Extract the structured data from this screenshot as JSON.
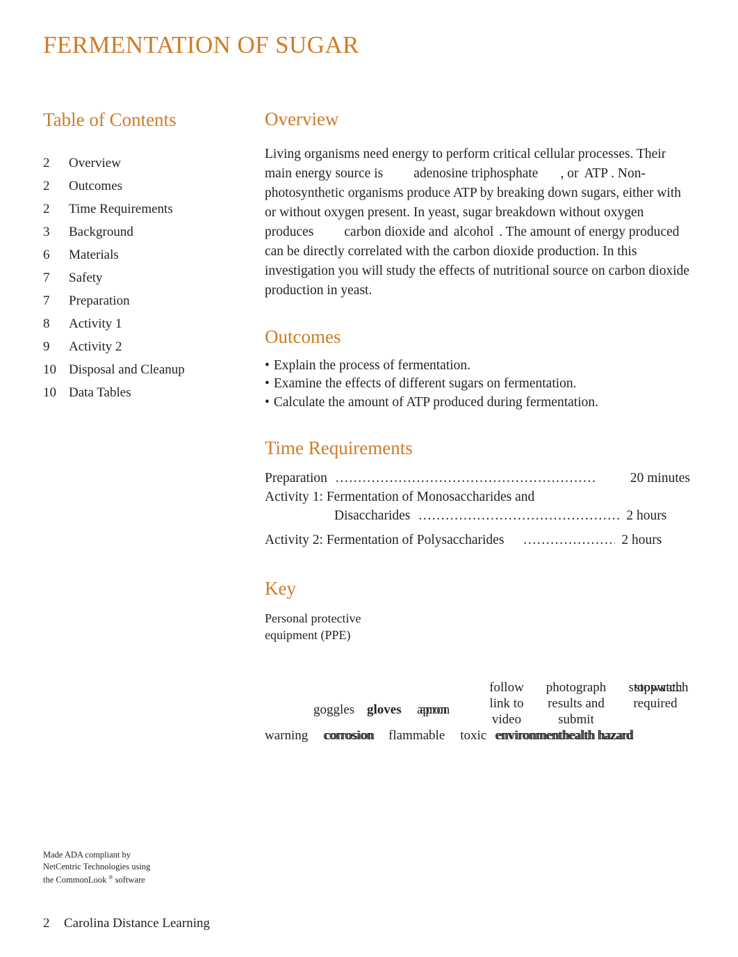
{
  "document": {
    "title": "FERMENTATION OF SUGAR",
    "accent_color": "#cf7b27",
    "text_color": "#231f20",
    "background_color": "#ffffff"
  },
  "toc": {
    "heading": "Table of Contents",
    "entries": [
      {
        "page": "2",
        "label": "Overview"
      },
      {
        "page": "2",
        "label": "Outcomes"
      },
      {
        "page": "2",
        "label": "Time Requirements"
      },
      {
        "page": "3",
        "label": "Background"
      },
      {
        "page": "6",
        "label": "Materials"
      },
      {
        "page": "7",
        "label": "Safety"
      },
      {
        "page": "7",
        "label": "Preparation"
      },
      {
        "page": "8",
        "label": "Activity 1"
      },
      {
        "page": "9",
        "label": "Activity 2"
      },
      {
        "page": "10",
        "label": "Disposal and Cleanup"
      },
      {
        "page": "10",
        "label": "Data Tables"
      }
    ]
  },
  "overview": {
    "heading": "Overview",
    "paragraph_parts": {
      "p1": "Living organisms need energy to perform critical cellular processes. Their main energy source is",
      "p2": "adenosine triphosphate",
      "p3": ",",
      "p4": "or",
      "p5": "ATP",
      "p6": ". Non-photosynthetic organisms produce ATP by breaking down sugars, either with or without oxygen present. In yeast, sugar breakdown without oxygen produces",
      "p7": "carbon dioxide",
      "p8": "and",
      "p9": "alcohol",
      "p10": ". The amount of energy produced can be directly correlated with the carbon dioxide production. In this investigation you will study the effects of nutritional source on carbon dioxide production in yeast."
    }
  },
  "outcomes": {
    "heading": "Outcomes",
    "bullet": "•",
    "items": [
      "Explain the process of fermentation.",
      "Examine the effects of different sugars on fermentation.",
      "Calculate the amount of ATP produced during fermentation."
    ]
  },
  "time_requirements": {
    "heading": "Time Requirements",
    "rows": [
      {
        "label": "Preparation",
        "leader": "..........................................................",
        "value": "20 minutes"
      },
      {
        "label": "Activity 1: Fermentation of Monosaccharides and",
        "leader": "",
        "value": ""
      },
      {
        "label": "Disaccharides",
        "leader": ".....................................................",
        "value": "2 hours"
      },
      {
        "label": "Activity 2: Fermentation of Polysaccharides",
        "leader": ".........................",
        "value": "2 hours"
      }
    ]
  },
  "key": {
    "heading": "Key",
    "ppe_label": "Personal protective equipment (PPE)",
    "items": [
      {
        "name": "goggles",
        "bold": false,
        "doubled": false
      },
      {
        "name": "gloves",
        "bold": true,
        "doubled": false
      },
      {
        "name": "apron",
        "bold": false,
        "doubled": true
      },
      {
        "name": "follow link to video",
        "bold": false,
        "doubled": false
      },
      {
        "name": "photograph results and submit",
        "bold": false,
        "doubled": false
      },
      {
        "name": "stopwatch required",
        "bold": false,
        "doubled": true
      }
    ],
    "item_labels": {
      "goggles": "goggles",
      "gloves": "gloves",
      "apron": "apron",
      "follow_line1": "follow",
      "follow_line2": "link to",
      "follow_line3": "video",
      "photograph_line1": "photograph",
      "photograph_line2": "results and",
      "photograph_line3": "submit",
      "stopwatch": "stopwatch",
      "required": "required"
    },
    "hazards": [
      {
        "name": "warning",
        "doubled": false
      },
      {
        "name": "corrosion",
        "doubled": true
      },
      {
        "name": "flammable",
        "doubled": false
      },
      {
        "name": "toxic",
        "doubled": false
      },
      {
        "name": "environment",
        "doubled": true
      },
      {
        "name": "health hazard",
        "doubled": true
      }
    ]
  },
  "ada_note": {
    "line1": "Made ADA compliant by",
    "line2": "NetCentric Technologies using",
    "line3_a": "the CommonLook",
    "line3_reg": "®",
    "line3_b": "software"
  },
  "page_footer": {
    "page_number": "2",
    "publisher": "Carolina Distance Learning"
  }
}
